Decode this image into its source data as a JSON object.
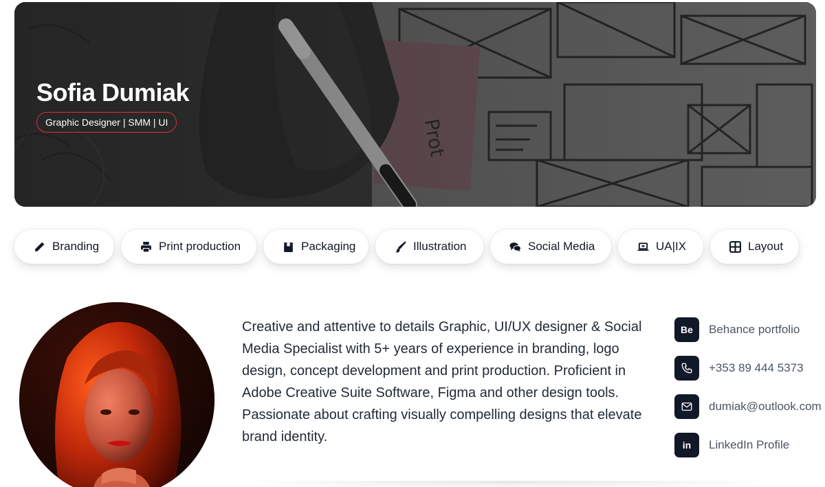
{
  "hero": {
    "name": "Sofia Dumiak",
    "role": "Graphic Designer | SMM | UI"
  },
  "skills": [
    {
      "label": "Branding",
      "icon": "pencil-icon"
    },
    {
      "label": "Print production",
      "icon": "printer-icon"
    },
    {
      "label": "Packaging",
      "icon": "box-icon"
    },
    {
      "label": "Illustration",
      "icon": "brush-icon"
    },
    {
      "label": "Social Media",
      "icon": "comments-icon"
    },
    {
      "label": "UA|IX",
      "icon": "laptop-icon"
    },
    {
      "label": "Layout",
      "icon": "grid-icon"
    }
  ],
  "bio": "Creative and attentive to details Graphic, UI/UX designer & Social Media Specialist with 5+ years of experience in branding, logo design, concept development and print production. Proficient in Adobe Creative Suite Software, Figma and other design tools. Passionate about crafting visually compelling designs that elevate brand identity.",
  "contacts": [
    {
      "icon_text": "Be",
      "icon": "behance-icon",
      "label": "Behance portfolio"
    },
    {
      "icon": "phone-icon",
      "label": "+353 89 444 5373"
    },
    {
      "icon": "mail-icon",
      "label": "dumiak@outlook.com"
    },
    {
      "icon_text": "in",
      "icon": "linkedin-icon",
      "label": "LinkedIn Profile"
    }
  ],
  "colors": {
    "accent_border": "#e0303a",
    "icon_bg": "#111827",
    "text_dark": "#1f2937",
    "text_muted": "#4b5563"
  }
}
